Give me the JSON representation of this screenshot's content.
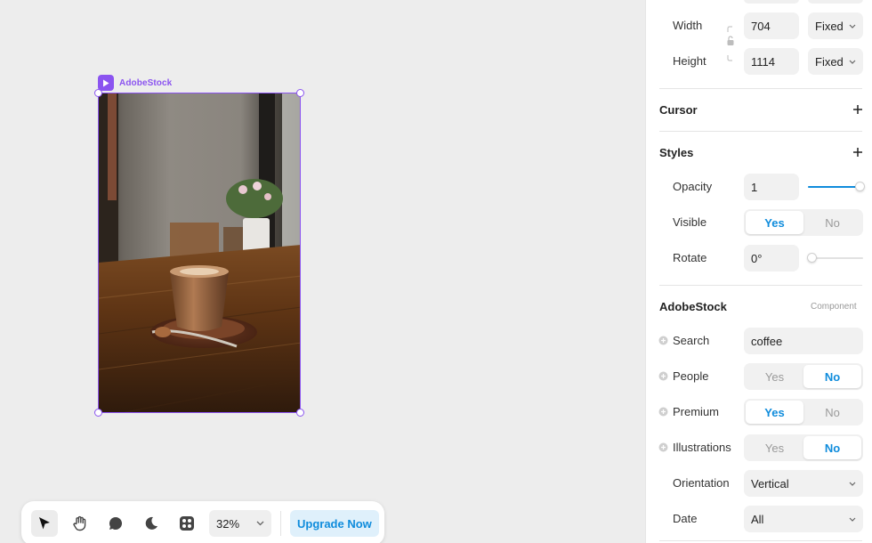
{
  "canvas": {
    "frame_name": "AdobeStock",
    "frame_image": "coffee-cup-photo"
  },
  "toolbar": {
    "tools": [
      {
        "name": "select-tool",
        "icon": "arrow-pointer-icon",
        "active": true
      },
      {
        "name": "hand-tool",
        "icon": "hand-icon",
        "active": false
      },
      {
        "name": "comment-tool",
        "icon": "speech-bubble-icon",
        "active": false
      },
      {
        "name": "dark-mode-tool",
        "icon": "moon-icon",
        "active": false
      },
      {
        "name": "components-tool",
        "icon": "components-icon",
        "active": false
      }
    ],
    "zoom": "32%",
    "upgrade_label": "Upgrade Now"
  },
  "panel": {
    "size": {
      "width_label": "Width",
      "width_value": "704",
      "width_mode": "Fixed",
      "height_label": "Height",
      "height_value": "1114",
      "height_mode": "Fixed"
    },
    "cursor": {
      "title": "Cursor"
    },
    "styles": {
      "title": "Styles",
      "opacity_label": "Opacity",
      "opacity_value": "1",
      "opacity_level": 1,
      "visible_label": "Visible",
      "visible_yes": "Yes",
      "visible_no": "No",
      "visible_selected": "Yes",
      "rotate_label": "Rotate",
      "rotate_value": "0°",
      "rotate_level": 0
    },
    "component": {
      "title": "AdobeStock",
      "tag": "Component",
      "search_label": "Search",
      "search_value": "coffee",
      "people_label": "People",
      "people_yes": "Yes",
      "people_no": "No",
      "people_selected": "No",
      "premium_label": "Premium",
      "premium_yes": "Yes",
      "premium_no": "No",
      "premium_selected": "Yes",
      "illustrations_label": "Illustrations",
      "illustrations_yes": "Yes",
      "illustrations_no": "No",
      "illustrations_selected": "No",
      "orientation_label": "Orientation",
      "orientation_value": "Vertical",
      "date_label": "Date",
      "date_value": "All"
    }
  },
  "colors": {
    "accent_purple": "#8b54f0",
    "accent_blue": "#0f8cdc"
  }
}
